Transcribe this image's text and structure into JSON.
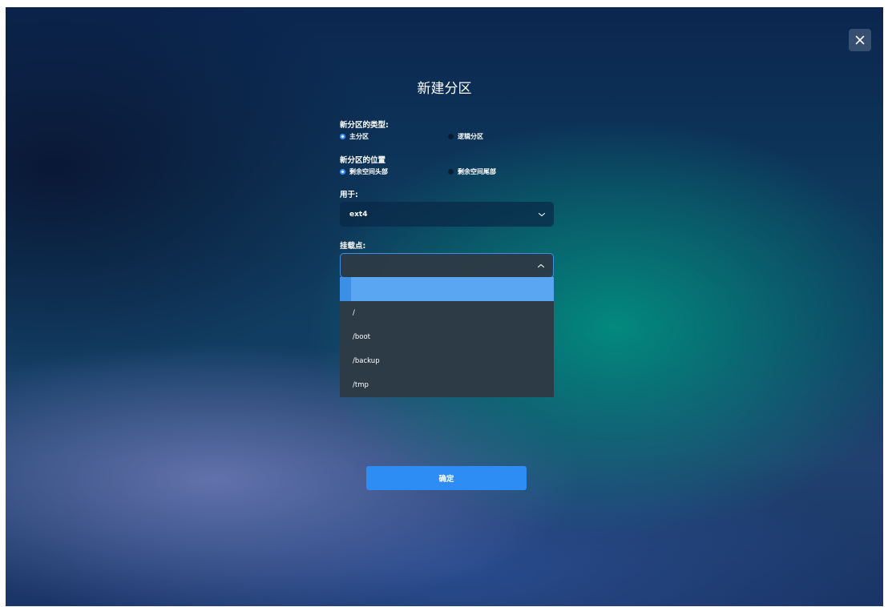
{
  "dialog": {
    "title": "新建分区",
    "close_icon": "close-icon"
  },
  "partition_type": {
    "label": "新分区的类型:",
    "options": [
      {
        "label": "主分区",
        "selected": true
      },
      {
        "label": "逻辑分区",
        "selected": false
      }
    ]
  },
  "partition_location": {
    "label": "新分区的位置",
    "options": [
      {
        "label": "剩余空间头部",
        "selected": true
      },
      {
        "label": "剩余空间尾部",
        "selected": false
      }
    ]
  },
  "filesystem": {
    "label": "用于:",
    "value": "ext4",
    "icon": "chevron-down-icon"
  },
  "mount_point": {
    "label": "挂载点:",
    "value": "",
    "icon": "chevron-up-icon",
    "options": [
      "",
      "/",
      "/boot",
      "/backup",
      "/tmp"
    ],
    "highlighted_index": 0
  },
  "confirm_button": {
    "label": "确定"
  },
  "colors": {
    "accent": "#2e8cf5",
    "dropdown_bg": "#2d3b46",
    "highlight": "#5aa6f2"
  }
}
